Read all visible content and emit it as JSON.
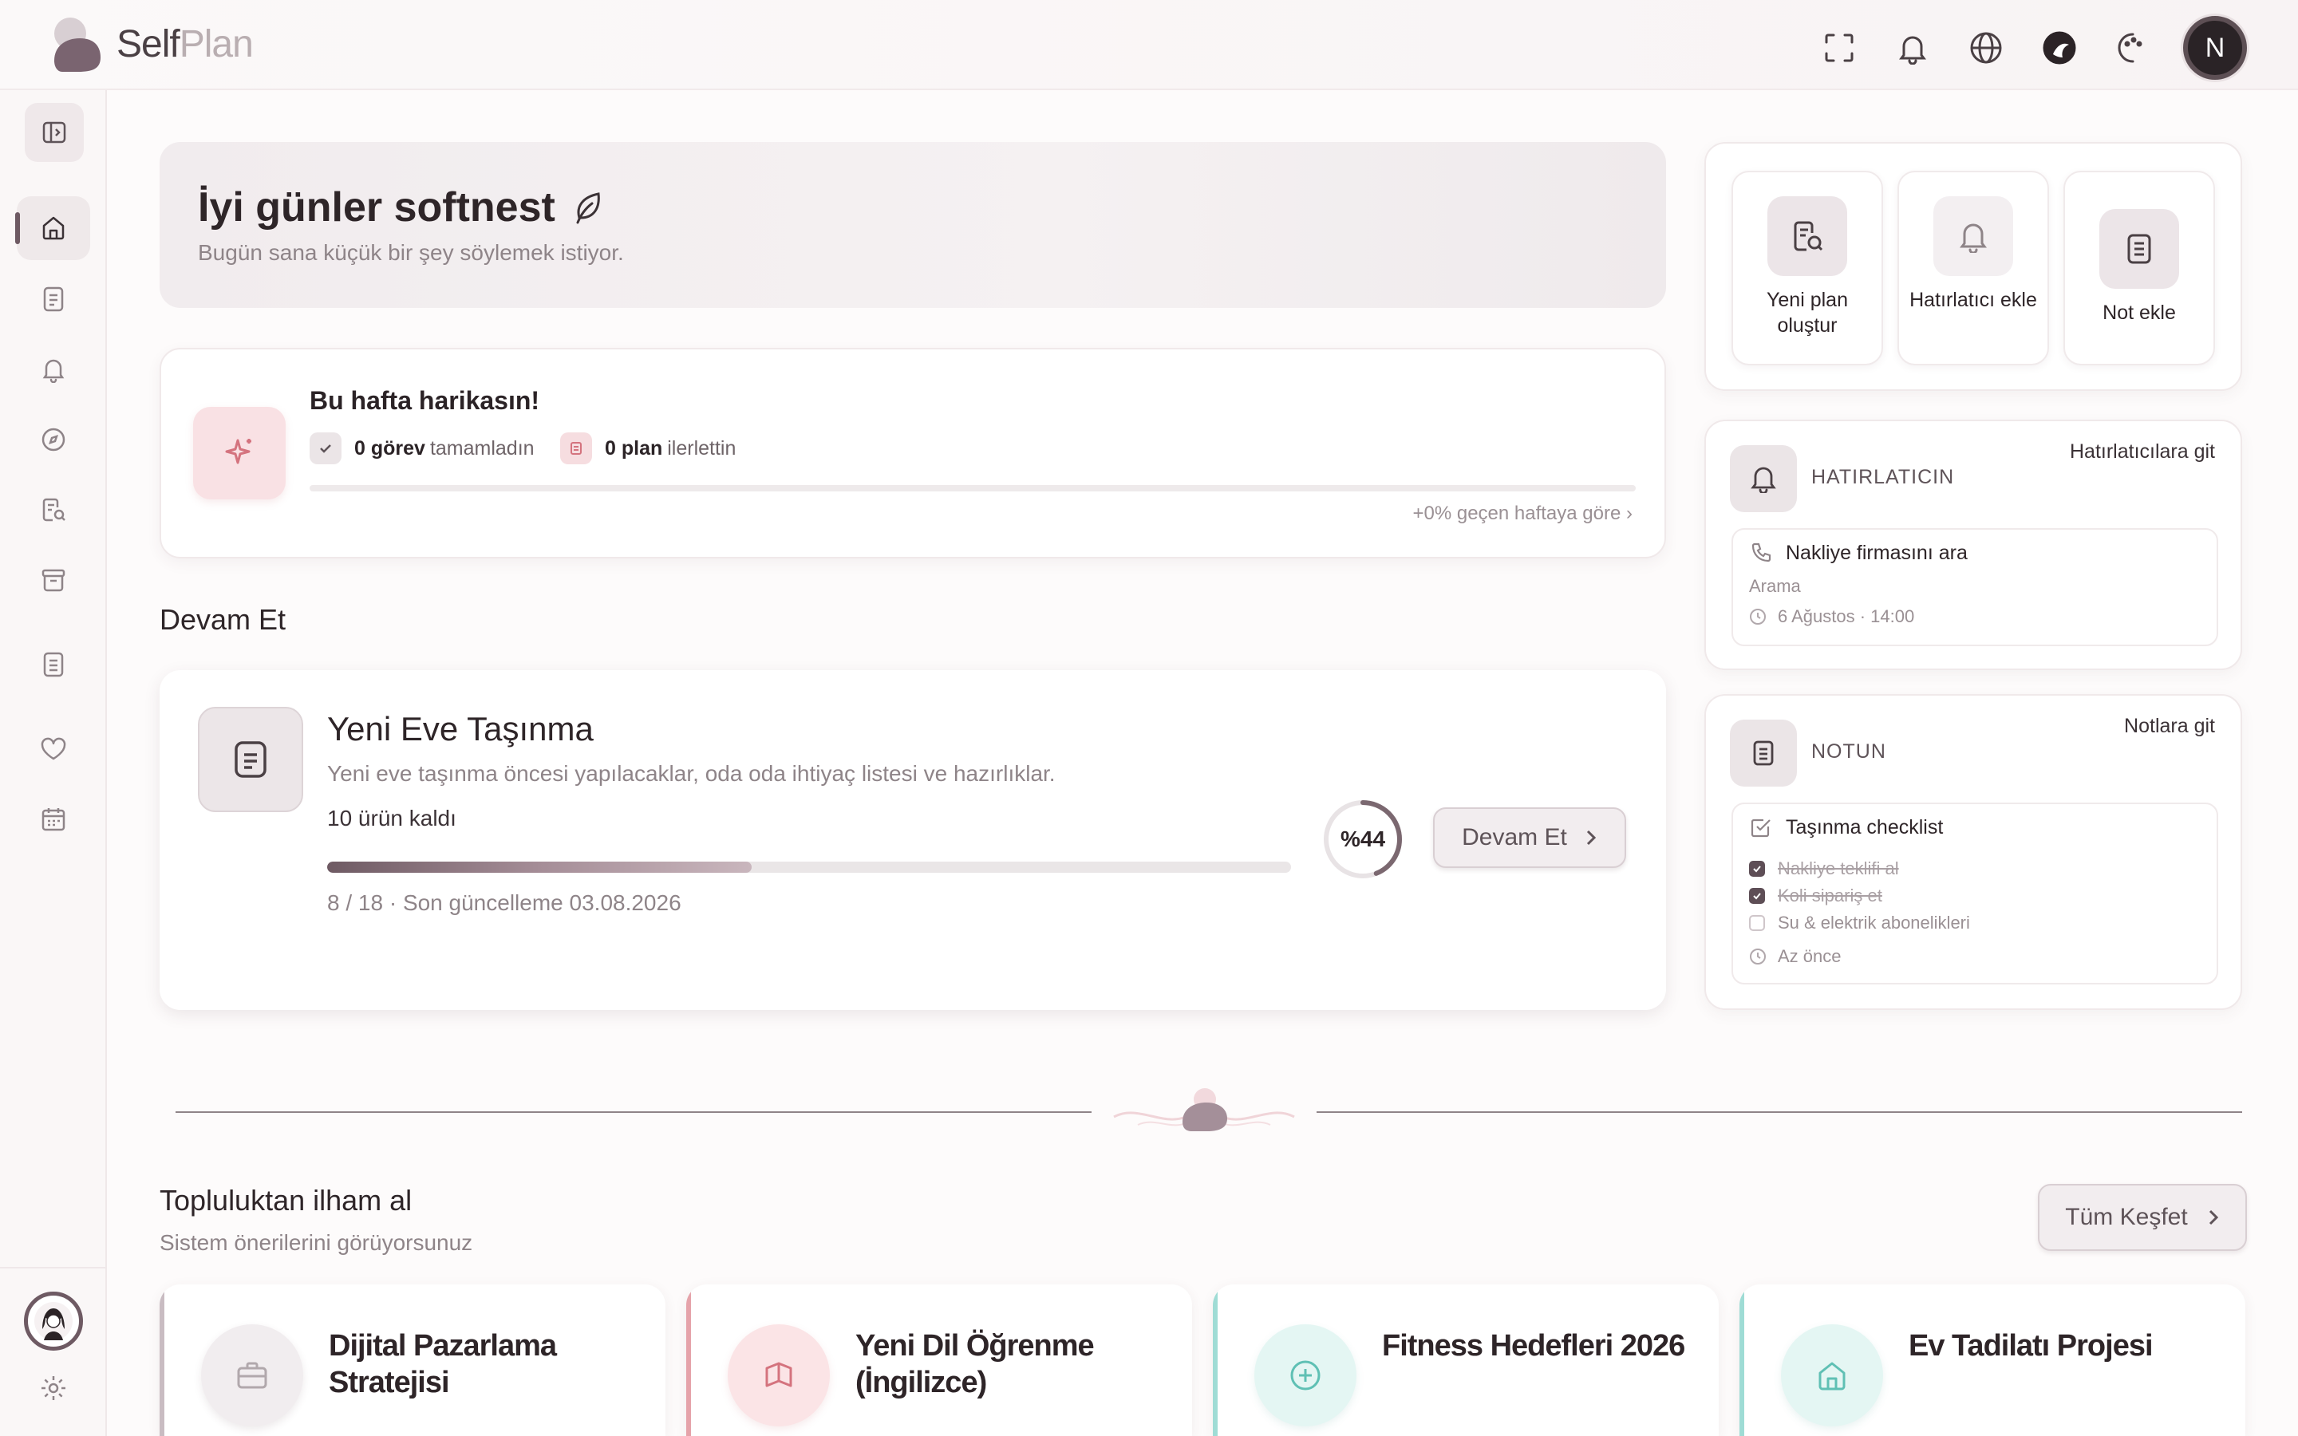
{
  "app": {
    "name_main": "Self",
    "name_accent": "Plan"
  },
  "greeting": {
    "title": "İyi günler softnest",
    "subtitle": "Bugün sana küçük bir şey söylemek istiyor."
  },
  "weekly": {
    "title": "Bu hafta harikasın!",
    "tasks_value": "0 görev",
    "tasks_text": "tamamladın",
    "plans_value": "0 plan",
    "plans_text": "ilerlettin",
    "comparison": "+0% geçen haftaya göre ›"
  },
  "continue_section": {
    "title": "Devam Et"
  },
  "continue_card": {
    "title": "Yeni Eve Taşınma",
    "description": "Yeni eve taşınma öncesi yapılacaklar, oda oda ihtiyaç listesi ve hazırlıklar.",
    "remaining": "10 ürün kaldı",
    "progress_percent": 44,
    "progress_label": "%44",
    "meta": "8 / 18 · Son güncelleme 03.08.2026",
    "button": "Devam Et"
  },
  "quick_actions": [
    {
      "label": "Yeni plan oluştur",
      "icon": "plan-add-icon"
    },
    {
      "label": "Hatırlatıcı ekle",
      "icon": "bell-icon"
    },
    {
      "label": "Not ekle",
      "icon": "note-icon"
    }
  ],
  "reminders": {
    "title": "HATIRLATICIN",
    "link": "Hatırlatıcılara git",
    "item_title": "Nakliye firmasını ara",
    "item_type": "Arama",
    "item_time": "6 Ağustos · 14:00"
  },
  "notes": {
    "title": "NOTUN",
    "link": "Notlara git",
    "note_title": "Taşınma checklist",
    "items": [
      {
        "text": "Nakliye teklifi al",
        "done": true
      },
      {
        "text": "Koli sipariş et",
        "done": true
      },
      {
        "text": "Su & elektrik abonelikleri",
        "done": false
      }
    ],
    "time": "Az önce"
  },
  "community": {
    "title": "Topluluktan ilham al",
    "subtitle": "Sistem önerilerini görüyorsunuz",
    "button": "Tüm Keşfet",
    "cards": [
      {
        "title": "Dijital Pazarlama Stratejisi",
        "icon": "briefcase-icon",
        "accent": "#c9bcc2"
      },
      {
        "title": "Yeni Dil Öğrenme (İngilizce)",
        "icon": "book-icon",
        "accent": "#e5a3aa"
      },
      {
        "title": "Fitness Hedefleri 2026",
        "icon": "plus-circle-icon",
        "accent": "#9fdcd5"
      },
      {
        "title": "Ev Tadilatı Projesi",
        "icon": "home-icon",
        "accent": "#9fdcd5"
      }
    ]
  },
  "user": {
    "initial": "N"
  },
  "colors": {
    "accent": "#6e5a63",
    "pink": "#f9e1e4",
    "mint": "#9fdcd5"
  }
}
